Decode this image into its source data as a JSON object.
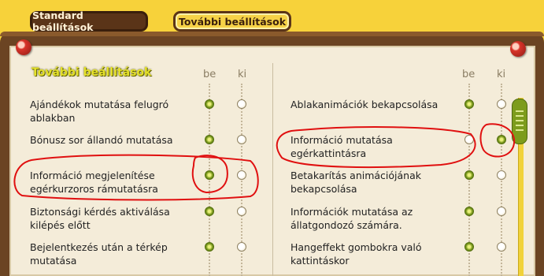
{
  "tabs": {
    "standard_label": "Standard beállítások",
    "further_label": "További beállítások"
  },
  "section_title": "További beállítások",
  "columns": {
    "on_label": "be",
    "off_label": "ki"
  },
  "left_settings": [
    {
      "line1": "Ajándékok mutatása felugró",
      "line2": "ablakban",
      "state": "be"
    },
    {
      "line1": "Bónusz sor állandó mutatása",
      "line2": "",
      "state": "be"
    },
    {
      "line1": "Információ megjelenítése",
      "line2": "egérkurzoros rámutatásra",
      "state": "be"
    },
    {
      "line1": "Biztonsági kérdés aktiválása",
      "line2": "kilépés előtt",
      "state": "be"
    },
    {
      "line1": "Bejelentkezés után a térkép",
      "line2": "mutatása",
      "state": "be"
    }
  ],
  "right_settings": [
    {
      "line1": "Ablakanimációk bekapcsolása",
      "line2": "",
      "state": "be"
    },
    {
      "line1": "Információ mutatása",
      "line2": "egérkattintásra",
      "state": "ki"
    },
    {
      "line1": "Betakarítás animációjának",
      "line2": "bekapcsolása",
      "state": "be"
    },
    {
      "line1": "Információk mutatása az",
      "line2": "állatgondozó számára.",
      "state": "be"
    },
    {
      "line1": "Hangeffekt gombokra való",
      "line2": "kattintáskor",
      "state": "be"
    }
  ],
  "colors": {
    "accent_yellow": "#f7d23a",
    "wood": "#6b4423",
    "radio_on": "#7b9a1e",
    "annotation_red": "#e01010"
  },
  "icons": [
    "pushpin-icon",
    "radio-on-icon",
    "radio-off-icon",
    "scrollbar-thumb-icon"
  ]
}
